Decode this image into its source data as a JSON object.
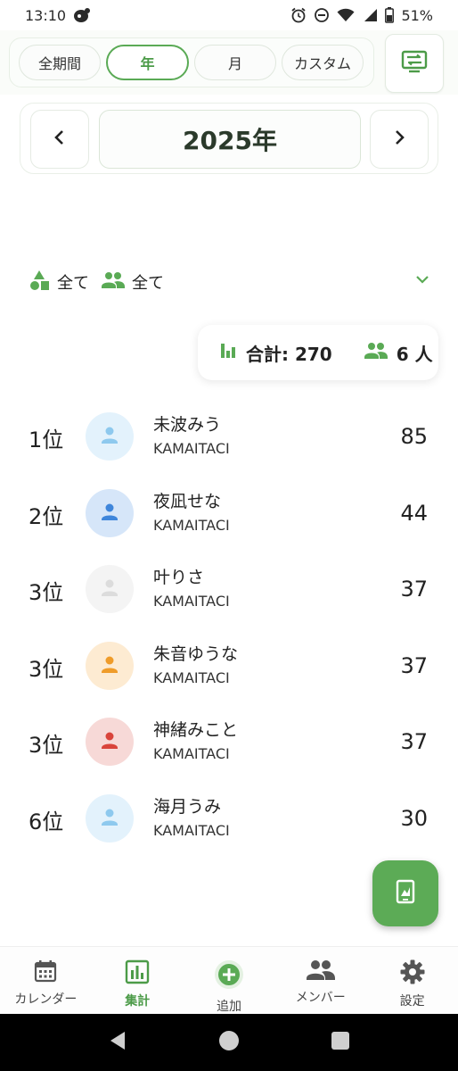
{
  "status_bar": {
    "time": "13:10",
    "battery": "51%"
  },
  "period_tabs": [
    {
      "label": "全期間",
      "active": false
    },
    {
      "label": "年",
      "active": true
    },
    {
      "label": "月",
      "active": false
    },
    {
      "label": "カスタム",
      "active": false
    }
  ],
  "year_selector": {
    "year": "2025年"
  },
  "filters": {
    "category": "全て",
    "members": "全て"
  },
  "summary": {
    "total_label": "合計: 270",
    "people_label": "6 人"
  },
  "ranking": [
    {
      "rank": "1位",
      "name": "未波みう",
      "sub": "KAMAITACI",
      "score": "85",
      "color": "#8ec9ee",
      "bg": "#e3f2fc"
    },
    {
      "rank": "2位",
      "name": "夜凪せな",
      "sub": "KAMAITACI",
      "score": "44",
      "color": "#3f86db",
      "bg": "#d6e6f9"
    },
    {
      "rank": "3位",
      "name": "叶りさ",
      "sub": "KAMAITACI",
      "score": "37",
      "color": "#dcdcdc",
      "bg": "#f4f4f4"
    },
    {
      "rank": "3位",
      "name": "朱音ゆうな",
      "sub": "KAMAITACI",
      "score": "37",
      "color": "#ef9c2a",
      "bg": "#fdebd2"
    },
    {
      "rank": "3位",
      "name": "神緒みこと",
      "sub": "KAMAITACI",
      "score": "37",
      "color": "#d9443b",
      "bg": "#f7d9d7"
    },
    {
      "rank": "6位",
      "name": "海月うみ",
      "sub": "KAMAITACI",
      "score": "30",
      "color": "#8ec9ee",
      "bg": "#e3f2fc"
    }
  ],
  "bottom_nav": [
    {
      "label": "カレンダー",
      "icon": "calendar-icon",
      "active": false
    },
    {
      "label": "集計",
      "icon": "bar-chart-icon",
      "active": true
    },
    {
      "label": "追加",
      "icon": "add-circle-icon",
      "active": false
    },
    {
      "label": "メンバー",
      "icon": "people-icon",
      "active": false
    },
    {
      "label": "設定",
      "icon": "gear-icon",
      "active": false
    }
  ],
  "colors": {
    "accent": "#5aaa55",
    "accent_text": "#4c9b48"
  }
}
